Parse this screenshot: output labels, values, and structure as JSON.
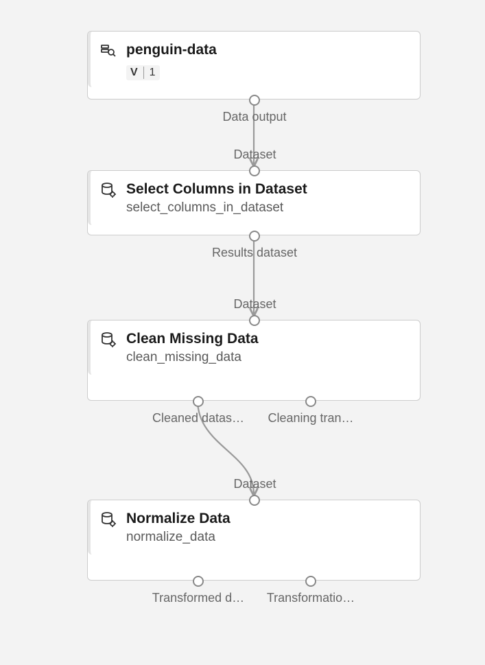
{
  "nodes": {
    "penguin": {
      "title": "penguin-data",
      "badge_label": "V",
      "badge_value": "1",
      "out_port": "Data output",
      "icon": "dataset-search-icon"
    },
    "select": {
      "title": "Select Columns in Dataset",
      "subtitle": "select_columns_in_dataset",
      "in_port": "Dataset",
      "out_port": "Results dataset",
      "icon": "db-gear-icon"
    },
    "clean": {
      "title": "Clean Missing Data",
      "subtitle": "clean_missing_data",
      "in_port": "Dataset",
      "out_port_1": "Cleaned datas…",
      "out_port_2": "Cleaning tran…",
      "icon": "db-gear-icon"
    },
    "normalize": {
      "title": "Normalize Data",
      "subtitle": "normalize_data",
      "in_port": "Dataset",
      "out_port_1": "Transformed d…",
      "out_port_2": "Transformatio…",
      "icon": "db-gear-icon"
    }
  }
}
